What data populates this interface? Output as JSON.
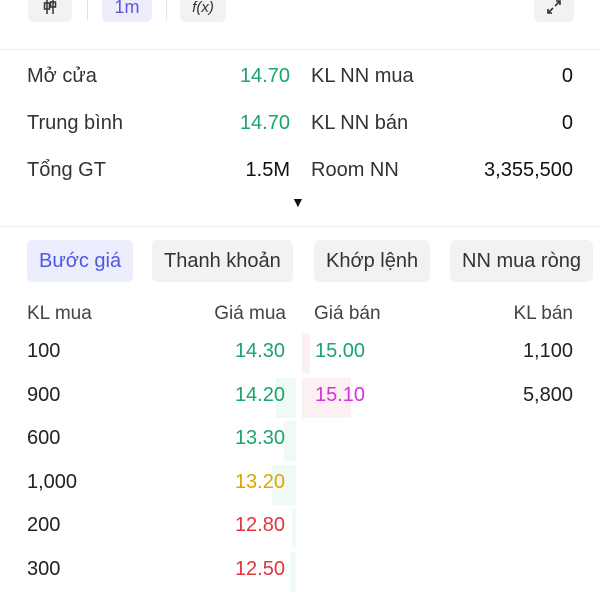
{
  "toolbar": {
    "interval_label": "1m",
    "indicator_label": "f(x)"
  },
  "stats": {
    "rows": [
      {
        "label": "Mở cửa",
        "value": "14.70",
        "label2": "KL NN mua",
        "value2": "0"
      },
      {
        "label": "Trung bình",
        "value": "14.70",
        "label2": "KL NN bán",
        "value2": "0"
      },
      {
        "label": "Tổng GT",
        "value": "1.5M",
        "label2": "Room NN",
        "value2": "3,355,500"
      }
    ]
  },
  "tabs": [
    {
      "label": "Bước giá",
      "active": true
    },
    {
      "label": "Thanh khoản",
      "active": false
    },
    {
      "label": "Khớp lệnh",
      "active": false
    },
    {
      "label": "NN mua ròng",
      "active": false
    }
  ],
  "order_book": {
    "headers": {
      "buy_volume": "KL mua",
      "buy_price": "Giá mua",
      "sell_price": "Giá bán",
      "sell_volume": "KL bán"
    },
    "rows": [
      {
        "buy_volume": "100",
        "buy_price": "14.30",
        "buy_color": "green",
        "buy_fill": 0.0,
        "sell_price": "15.00",
        "sell_color": "green",
        "sell_volume": "1,100",
        "sell_fill": 0.12
      },
      {
        "buy_volume": "900",
        "buy_price": "14.20",
        "buy_color": "green",
        "buy_fill": 0.5,
        "sell_price": "15.10",
        "sell_color": "purple",
        "sell_volume": "5,800",
        "sell_fill": 0.7
      },
      {
        "buy_volume": "600",
        "buy_price": "13.30",
        "buy_color": "green",
        "buy_fill": 0.3,
        "sell_price": "",
        "sell_color": "",
        "sell_volume": "",
        "sell_fill": 0
      },
      {
        "buy_volume": "1,000",
        "buy_price": "13.20",
        "buy_color": "yellow",
        "buy_fill": 0.6,
        "sell_price": "",
        "sell_color": "",
        "sell_volume": "",
        "sell_fill": 0
      },
      {
        "buy_volume": "200",
        "buy_price": "12.80",
        "buy_color": "red",
        "buy_fill": 0.1,
        "sell_price": "",
        "sell_color": "",
        "sell_volume": "",
        "sell_fill": 0
      },
      {
        "buy_volume": "300",
        "buy_price": "12.50",
        "buy_color": "red",
        "buy_fill": 0.15,
        "sell_price": "",
        "sell_color": "",
        "sell_volume": "",
        "sell_fill": 0
      }
    ]
  }
}
